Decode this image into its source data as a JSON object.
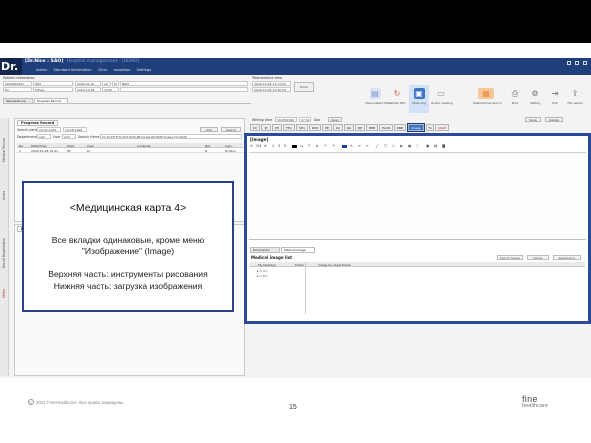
{
  "app": {
    "logo": "Dr.",
    "title": "[Dr.Nice : SAO]",
    "subtitle": "Hospital management · [DEMO]",
    "menu": [
      "Admin",
      "Standard information",
      "Clinic",
      "reception",
      "Settings"
    ]
  },
  "patient": {
    "section_label": "Patient information",
    "id": "0000000091",
    "name": "JDM",
    "birth": "2000-01-01",
    "age": "22",
    "sex": "M",
    "type": "NRM",
    "room": "RV",
    "doctor": "SHSes",
    "visit_date": "2020-10-28",
    "visit_code": "1238"
  },
  "record_tabs": [
    "Telemedicine",
    "Progress Record"
  ],
  "telemedicine": {
    "label": "Telemedicine time",
    "start": "2020-10-28 13:11:02",
    "end": "2020-10-28 13:46:59",
    "button": "Done"
  },
  "toolbar_icons": [
    {
      "label": "Show patient file",
      "icon": "doc-icon",
      "color": "#7a93c4"
    },
    {
      "label": "Refresh RTS",
      "icon": "refresh-icon",
      "color": "#d45a4a"
    },
    {
      "label": "Show img",
      "icon": "image-icon",
      "color": "#3f73c6"
    },
    {
      "label": "Online meeting",
      "icon": "meeting-icon",
      "color": "#8c8c8c"
    },
    {
      "label": "Telemedicine launch",
      "icon": "launch-icon",
      "color": "#e8893a"
    },
    {
      "label": "Print",
      "icon": "print-icon",
      "color": "#707070"
    },
    {
      "label": "Setting",
      "icon": "setting-icon",
      "color": "#707070"
    },
    {
      "label": "Exit",
      "icon": "exit-icon",
      "color": "#707070"
    },
    {
      "label": "File upload",
      "icon": "upload-icon",
      "color": "#707070"
    }
  ],
  "leftnav": [
    "Medical Record",
    "Order",
    "Result Registration",
    "Other"
  ],
  "progress_panel": {
    "header": "Progress Record",
    "date_label": "Search period",
    "date_from": "10-04-2019",
    "date_to": "10-28-2020",
    "dept_label": "Department",
    "dept_value": "(all)",
    "user_label": "User",
    "user_value": "(all)",
    "search_items_label": "Search items",
    "search_items_value": "CC,PI,PH,FHx,SHx,ROS,PE,Dx,RA,RP,RMP,Image,TX,SOAP",
    "add_button": "Add",
    "search_button": "Search",
    "columns": [
      "No",
      "Date/Time",
      "Dept",
      "User",
      "Contents",
      "Rpt",
      "Sign"
    ],
    "rows": [
      [
        "1",
        "2020-10-28 19:41",
        "IM",
        "Dr",
        "",
        "N",
        "Dr.Nice"
      ]
    ]
  },
  "progress_panel2": {
    "header": "Progress Record"
  },
  "right_header": {
    "writing_time_label": "Writing time",
    "writing_time_value": "10/28/2020",
    "time_value": "17:01",
    "doc_label": "Doc",
    "open_button": "Open",
    "sheet_tabs": [
      "CC",
      "PI",
      "PH",
      "FHx",
      "SHx",
      "ROS",
      "PE",
      "Dx",
      "RA",
      "RP",
      "RMP",
      "PLAN",
      "RMP",
      "Image",
      "Tx",
      "SOAP"
    ],
    "selected_tab": "Image",
    "save_button": "Save",
    "delete_button": "Delete"
  },
  "image_panel": {
    "title": "[Image]",
    "zoom": "2/4",
    "line_widths": [
      "1",
      "3",
      "5"
    ],
    "tool_labels": [
      "T",
      "A",
      "↶",
      "↷"
    ],
    "upload_tabs": [
      "EchoCardio",
      "Medical Image"
    ],
    "list_title": "Medical image list",
    "list_buttons": [
      "Import images",
      "Delete",
      "Registration"
    ],
    "columns": [
      "My Desktop",
      "Folder",
      "Image by department"
    ],
    "tree": [
      "C:\\",
      "D:\\"
    ]
  },
  "callout": {
    "title": "<Медицинская карта 4>",
    "line1": "Все вкладки одинаковые, кроме меню",
    "line2": "\"Изображение\" (Image)",
    "line3": "Верхняя часть: инструменты рисования",
    "line4": "Нижняя часть: загрузка изображения"
  },
  "footer": {
    "copyright": "2021 FineHealthcare. Все права защищены.",
    "copy_symbol": "C",
    "page_number": "15",
    "brand_top": "fine",
    "brand_bottom": "healthcare"
  }
}
